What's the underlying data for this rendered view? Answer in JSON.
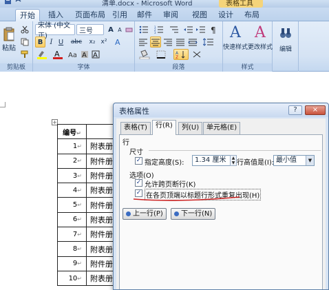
{
  "window": {
    "title": "清单.docx - Microsoft Word",
    "context_tab": "表格工具"
  },
  "ribbon": {
    "tabs": [
      "开始",
      "插入",
      "页面布局",
      "引用",
      "邮件",
      "审阅",
      "视图",
      "设计",
      "布局"
    ],
    "active_tab": "开始",
    "clipboard": {
      "paste": "粘贴",
      "label": "剪贴板"
    },
    "font": {
      "name": "宋体 (中文正)",
      "size": "三号",
      "bold": "B",
      "italic": "I",
      "underline": "U",
      "strikethrough": "abc",
      "subscript": "x₂",
      "superscript": "x²",
      "grow": "A",
      "shrink": "A",
      "label": "字体"
    },
    "paragraph": {
      "label": "段落"
    },
    "styles": {
      "quick": "快速样式",
      "change": "更改样式",
      "label": "样式"
    },
    "editing": {
      "label": "编辑"
    }
  },
  "document": {
    "table": {
      "header": "编号",
      "rows": [
        {
          "num": "1",
          "name": "附表册"
        },
        {
          "num": "2",
          "name": "附件册"
        },
        {
          "num": "3",
          "name": "附件册"
        },
        {
          "num": "4",
          "name": "附表册"
        },
        {
          "num": "5",
          "name": "附件册"
        },
        {
          "num": "6",
          "name": "附表册"
        },
        {
          "num": "7",
          "name": "附件册"
        },
        {
          "num": "8",
          "name": "附表册"
        },
        {
          "num": "9",
          "name": "附件册"
        },
        {
          "num": "10",
          "name": "附表册"
        }
      ],
      "cell_mark": "↵"
    }
  },
  "dialog": {
    "title": "表格属性",
    "help": "?",
    "close": "×",
    "tabs": [
      "表格(T)",
      "行(R)",
      "列(U)",
      "单元格(E)"
    ],
    "active_tab": "行(R)",
    "section_row": "行",
    "size_label": "尺寸",
    "specify_height": {
      "label": "指定高度(S):",
      "checked": true,
      "value": "1.34 厘米"
    },
    "height_is": {
      "label": "行高值是(I):",
      "value": "最小值"
    },
    "options_label": "选项(O)",
    "allow_break": {
      "label": "允许跨页断行(K)",
      "checked": true
    },
    "repeat_header": {
      "label": "在各页顶端以标题行形式重复出现(H)",
      "checked": true
    },
    "prev_row": "上一行(P)",
    "next_row": "下一行(N)"
  },
  "colors": {
    "ribbon_bg": "#d5e3f4",
    "dialog_bg": "#d7e4f4",
    "annotation": "#cc2222",
    "context_tab": "#f5d47a"
  }
}
